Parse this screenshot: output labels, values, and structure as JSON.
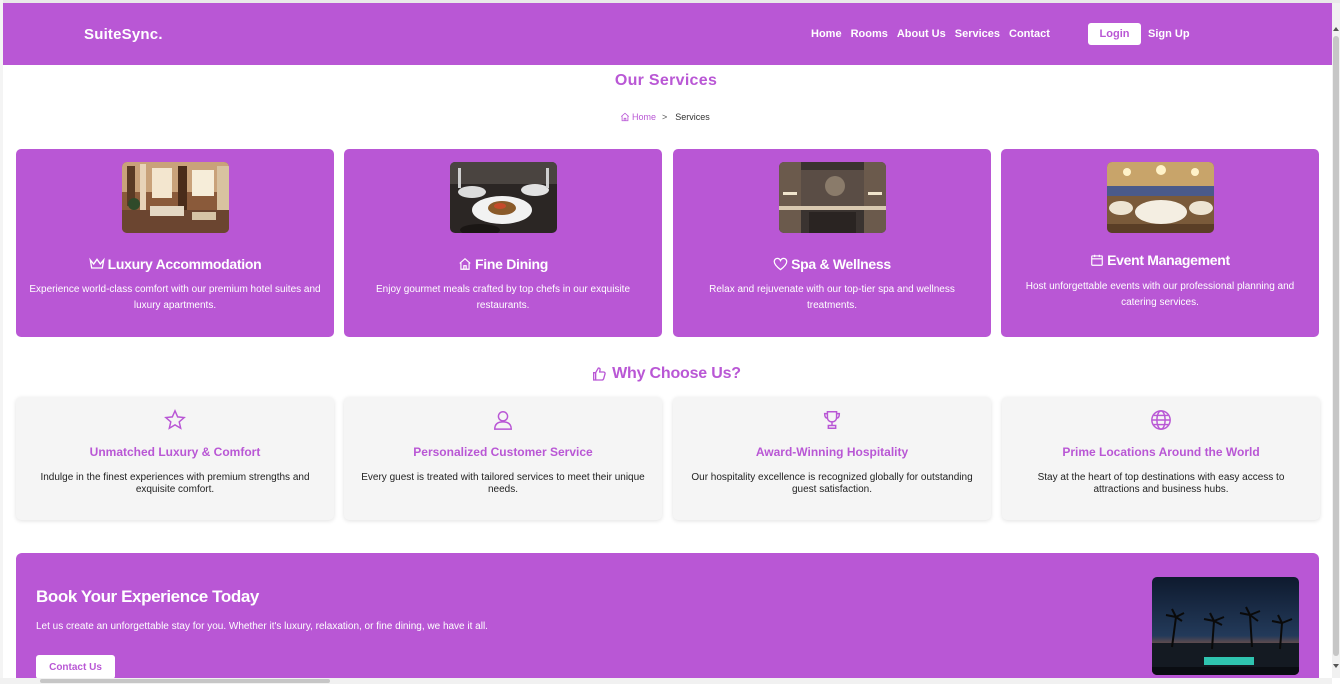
{
  "brand": "SuiteSync.",
  "nav": {
    "links": [
      "Home",
      "Rooms",
      "About Us",
      "Services",
      "Contact"
    ],
    "login": "Login",
    "signup": "Sign Up"
  },
  "page": {
    "title": "Our Services",
    "breadcrumb": {
      "home": "Home",
      "separator": ">",
      "current": "Services"
    }
  },
  "services": [
    {
      "icon": "crown-icon",
      "image": "hotel-lobby-image",
      "title": "Luxury Accommodation",
      "desc": "Experience world-class comfort with our premium hotel suites and luxury apartments."
    },
    {
      "icon": "home-icon",
      "image": "dining-table-image",
      "title": "Fine Dining",
      "desc": "Enjoy gourmet meals crafted by top chefs in our exquisite restaurants."
    },
    {
      "icon": "heart-icon",
      "image": "spa-room-image",
      "title": "Spa & Wellness",
      "desc": "Relax and rejuvenate with our top-tier spa and wellness treatments."
    },
    {
      "icon": "calendar-icon",
      "image": "banquet-hall-image",
      "title": "Event Management",
      "desc": "Host unforgettable events with our professional planning and catering services."
    }
  ],
  "why": {
    "icon": "thumbs-up-icon",
    "title": "Why Choose Us?",
    "features": [
      {
        "icon": "star-icon",
        "title": "Unmatched Luxury & Comfort",
        "desc": "Indulge in the finest experiences with premium strengths and exquisite comfort."
      },
      {
        "icon": "user-icon",
        "title": "Personalized Customer Service",
        "desc": "Every guest is treated with tailored services to meet their unique needs."
      },
      {
        "icon": "trophy-icon",
        "title": "Award-Winning Hospitality",
        "desc": "Our hospitality excellence is recognized globally for outstanding guest satisfaction."
      },
      {
        "icon": "globe-icon",
        "title": "Prime Locations Around the World",
        "desc": "Stay at the heart of top destinations with easy access to attractions and business hubs."
      }
    ]
  },
  "cta": {
    "title": "Book Your Experience Today",
    "text": "Let us create an unforgettable stay for you. Whether it's luxury, relaxation, or fine dining, we have it all.",
    "button": "Contact Us",
    "image": "resort-night-image"
  },
  "colors": {
    "accent": "#b957d5",
    "card_bg": "#f5f5f5",
    "white": "#ffffff"
  }
}
